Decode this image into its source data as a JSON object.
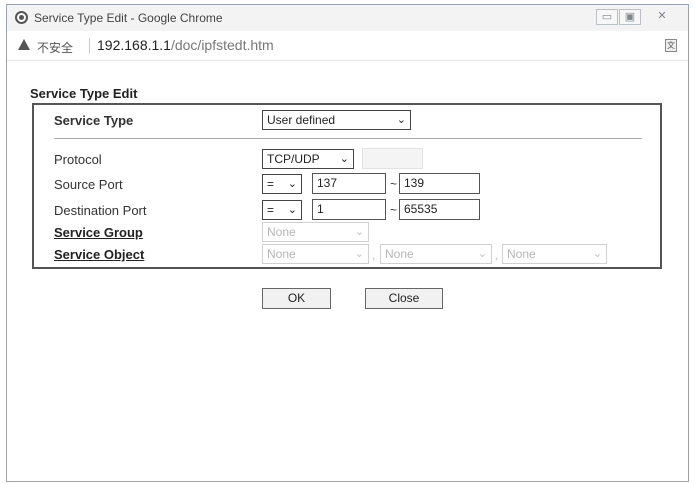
{
  "window": {
    "title": "Service Type Edit - Google Chrome",
    "controls": {
      "minimize": "▭",
      "maximize": "▣",
      "close": "✕"
    }
  },
  "address_bar": {
    "security_label": "不安全",
    "host": "192.168.1.1",
    "path": "/doc/ipfstedt.htm",
    "translate_icon": "translate-icon"
  },
  "form": {
    "heading": "Service Type Edit",
    "service_type": {
      "label": "Service Type",
      "value": "User defined"
    },
    "protocol": {
      "label": "Protocol",
      "value": "TCP/UDP",
      "extra_value": ""
    },
    "source_port": {
      "label": "Source Port",
      "operator": "=",
      "start": "137",
      "separator": "~",
      "end": "139"
    },
    "destination_port": {
      "label": "Destination Port",
      "operator": "=",
      "start": "1",
      "separator": "~",
      "end": "65535"
    },
    "service_group": {
      "label": "Service Group",
      "value": "None"
    },
    "service_object": {
      "label": "Service Object",
      "values": [
        "None",
        "None",
        "None"
      ],
      "separator": ","
    }
  },
  "buttons": {
    "ok": "OK",
    "close": "Close"
  }
}
